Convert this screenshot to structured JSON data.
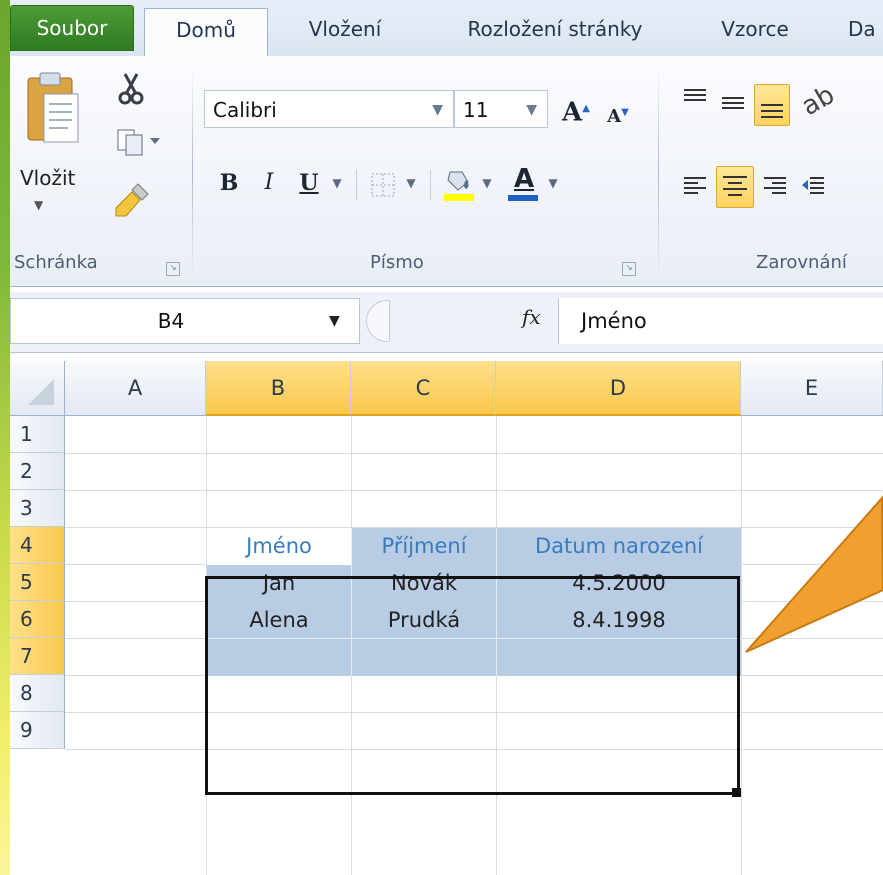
{
  "ribbon_tabs": [
    "Soubor",
    "Domů",
    "Vložení",
    "Rozložení stránky",
    "Vzorce",
    "Da"
  ],
  "clipboard": {
    "paste_label": "Vložit",
    "group_label": "Schránka"
  },
  "font": {
    "name": "Calibri",
    "size": "11",
    "group_label": "Písmo",
    "bold": "B",
    "italic": "I",
    "underline": "U",
    "grow": "A",
    "shrink": "A",
    "color_letter": "A"
  },
  "alignment": {
    "group_label": "Zarovnání"
  },
  "formula_bar": {
    "name_box": "B4",
    "fx": "fx",
    "content": "Jméno"
  },
  "grid": {
    "columns": [
      "A",
      "B",
      "C",
      "D",
      "E"
    ],
    "rows": [
      "1",
      "2",
      "3",
      "4",
      "5",
      "6",
      "7",
      "8",
      "9"
    ],
    "table_header": [
      "Jméno",
      "Příjmení",
      "Datum narození"
    ],
    "table_rows": [
      [
        "Jan",
        "Novák",
        "4.5.2000"
      ],
      [
        "Alena",
        "Prudká",
        "8.4.1998"
      ]
    ]
  },
  "colors": {
    "file_tab": "#3c8a2c",
    "selection_header": "#f9c84d",
    "table_fill": "#b8cce4",
    "header_text": "#3a7bbf",
    "callout": "#f0a030"
  }
}
